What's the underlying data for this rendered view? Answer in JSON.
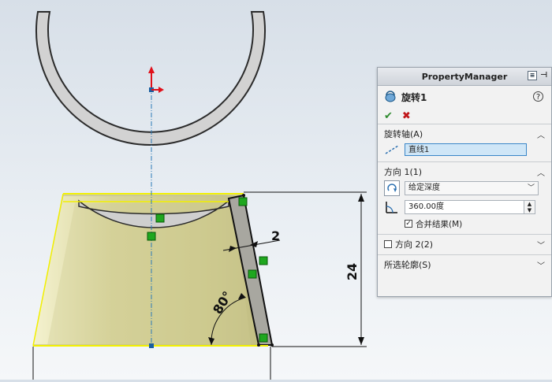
{
  "dimensions": {
    "linear_width": "2",
    "height": "24",
    "angle": "80°"
  },
  "property_manager": {
    "title": "PropertyManager",
    "feature_name": "旋转1",
    "ok_symbol": "✔",
    "cancel_symbol": "✖",
    "help_symbol": "?",
    "axis_group": {
      "label": "旋转轴(A)",
      "value": "直线1"
    },
    "direction1": {
      "label": "方向 1(1)",
      "end_condition": "给定深度",
      "angle_value": "360.00度",
      "merge_result_label": "合并结果(M)",
      "merge_result_checked": true
    },
    "direction2": {
      "label": "方向 2(2)",
      "checked": false
    },
    "selected_contours": {
      "label": "所选轮廓(S)"
    }
  },
  "colors": {
    "part_fill": "#d9d59c",
    "part_shade": "#e9e6b6",
    "sketch_yellow": "#f2f000",
    "sketch_green": "#1fa71f",
    "axis_blue": "#2a7ab8"
  }
}
